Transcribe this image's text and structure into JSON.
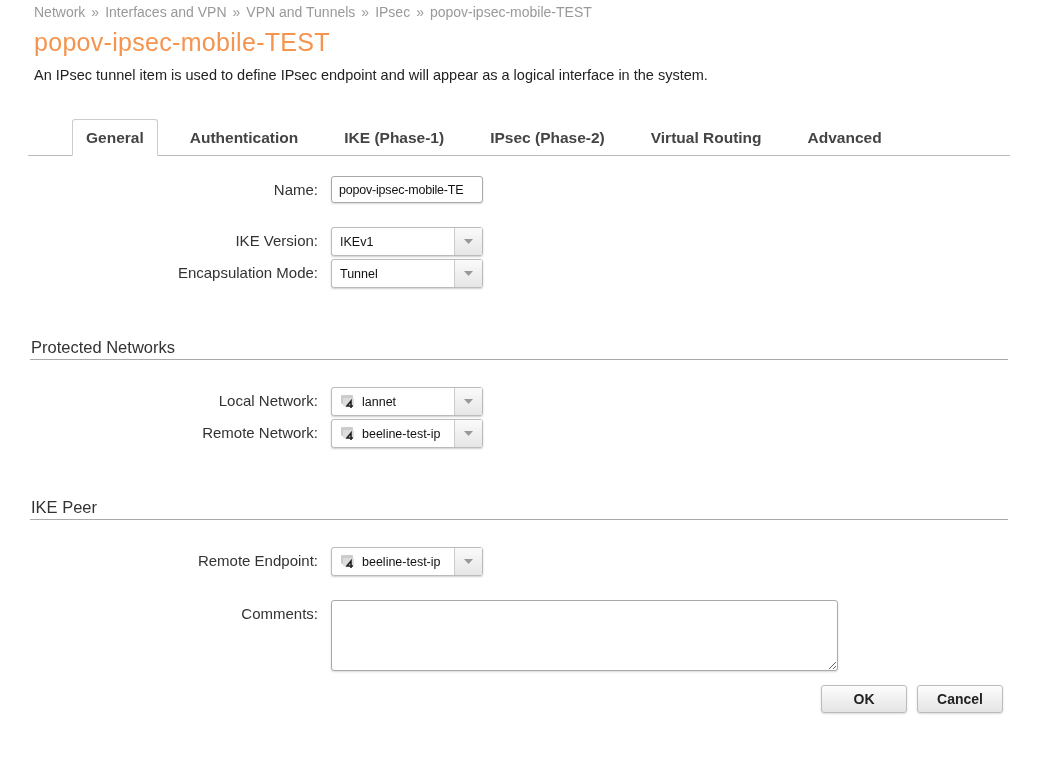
{
  "breadcrumb": [
    "Network",
    "Interfaces and VPN",
    "VPN and Tunnels",
    "IPsec",
    "popov-ipsec-mobile-TEST"
  ],
  "breadcrumb_separator": "»",
  "title": "popov-ipsec-mobile-TEST",
  "description": "An IPsec tunnel item is used to define IPsec endpoint and will appear as a logical interface in the system.",
  "tabs": [
    {
      "label": "General",
      "selected": true
    },
    {
      "label": "Authentication",
      "selected": false
    },
    {
      "label": "IKE (Phase-1)",
      "selected": false
    },
    {
      "label": "IPsec (Phase-2)",
      "selected": false
    },
    {
      "label": "Virtual Routing",
      "selected": false
    },
    {
      "label": "Advanced",
      "selected": false
    }
  ],
  "sections": [
    {
      "groups": [
        [
          {
            "label": "Name:",
            "kind": "text",
            "value": "popov-ipsec-mobile-TE"
          }
        ],
        [
          {
            "label": "IKE Version:",
            "kind": "select",
            "value": "IKEv1"
          },
          {
            "label": "Encapsulation Mode:",
            "kind": "select",
            "value": "Tunnel"
          }
        ]
      ]
    },
    {
      "heading": "Protected Networks",
      "groups": [
        [
          {
            "label": "Local Network:",
            "kind": "network",
            "value": "lannet"
          },
          {
            "label": "Remote Network:",
            "kind": "network",
            "value": "beeline-test-ip"
          }
        ]
      ]
    },
    {
      "heading": "IKE Peer",
      "groups": [
        [
          {
            "label": "Remote Endpoint:",
            "kind": "network",
            "value": "beeline-test-ip"
          }
        ],
        [
          {
            "label": "Comments:",
            "kind": "textarea"
          }
        ]
      ]
    }
  ],
  "buttons": [
    "OK",
    "Cancel"
  ]
}
